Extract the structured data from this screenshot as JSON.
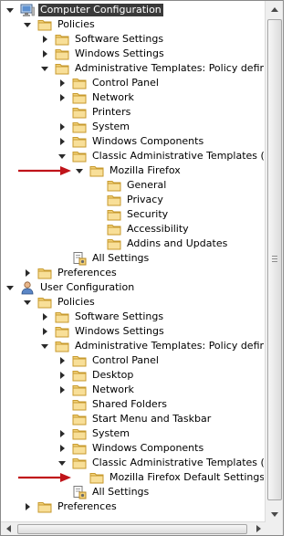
{
  "tree": {
    "rows": [
      {
        "label": "Computer Configuration",
        "level": 0,
        "expander": "down",
        "icon": "computer-icon",
        "selected": true
      },
      {
        "label": "Policies",
        "level": 1,
        "expander": "down",
        "icon": "folder-icon"
      },
      {
        "label": "Software Settings",
        "level": 2,
        "expander": "right",
        "icon": "folder-icon"
      },
      {
        "label": "Windows Settings",
        "level": 2,
        "expander": "right",
        "icon": "folder-icon"
      },
      {
        "label": "Administrative Templates: Policy definitio",
        "level": 2,
        "expander": "down",
        "icon": "folder-icon"
      },
      {
        "label": "Control Panel",
        "level": 3,
        "expander": "right",
        "icon": "folder-icon"
      },
      {
        "label": "Network",
        "level": 3,
        "expander": "right",
        "icon": "folder-icon"
      },
      {
        "label": "Printers",
        "level": 3,
        "expander": "none",
        "icon": "folder-icon"
      },
      {
        "label": "System",
        "level": 3,
        "expander": "right",
        "icon": "folder-icon"
      },
      {
        "label": "Windows Components",
        "level": 3,
        "expander": "right",
        "icon": "folder-icon"
      },
      {
        "label": "Classic Administrative Templates (AD",
        "level": 3,
        "expander": "down",
        "icon": "folder-icon"
      },
      {
        "label": "Mozilla Firefox",
        "level": 4,
        "expander": "down",
        "icon": "folder-icon"
      },
      {
        "label": "General",
        "level": 5,
        "expander": "none",
        "icon": "folder-icon"
      },
      {
        "label": "Privacy",
        "level": 5,
        "expander": "none",
        "icon": "folder-icon"
      },
      {
        "label": "Security",
        "level": 5,
        "expander": "none",
        "icon": "folder-icon"
      },
      {
        "label": "Accessibility",
        "level": 5,
        "expander": "none",
        "icon": "folder-icon"
      },
      {
        "label": "Addins and Updates",
        "level": 5,
        "expander": "none",
        "icon": "folder-icon"
      },
      {
        "label": "All Settings",
        "level": 3,
        "expander": "none",
        "icon": "all-settings-icon"
      },
      {
        "label": "Preferences",
        "level": 1,
        "expander": "right",
        "icon": "folder-icon"
      },
      {
        "label": "User Configuration",
        "level": 0,
        "expander": "down",
        "icon": "user-icon"
      },
      {
        "label": "Policies",
        "level": 1,
        "expander": "down",
        "icon": "folder-icon"
      },
      {
        "label": "Software Settings",
        "level": 2,
        "expander": "right",
        "icon": "folder-icon"
      },
      {
        "label": "Windows Settings",
        "level": 2,
        "expander": "right",
        "icon": "folder-icon"
      },
      {
        "label": "Administrative Templates: Policy definitio",
        "level": 2,
        "expander": "down",
        "icon": "folder-icon"
      },
      {
        "label": "Control Panel",
        "level": 3,
        "expander": "right",
        "icon": "folder-icon"
      },
      {
        "label": "Desktop",
        "level": 3,
        "expander": "right",
        "icon": "folder-icon"
      },
      {
        "label": "Network",
        "level": 3,
        "expander": "right",
        "icon": "folder-icon"
      },
      {
        "label": "Shared Folders",
        "level": 3,
        "expander": "none",
        "icon": "folder-icon"
      },
      {
        "label": "Start Menu and Taskbar",
        "level": 3,
        "expander": "none",
        "icon": "folder-icon"
      },
      {
        "label": "System",
        "level": 3,
        "expander": "right",
        "icon": "folder-icon"
      },
      {
        "label": "Windows Components",
        "level": 3,
        "expander": "right",
        "icon": "folder-icon"
      },
      {
        "label": "Classic Administrative Templates (AD",
        "level": 3,
        "expander": "down",
        "icon": "folder-icon"
      },
      {
        "label": "Mozilla Firefox Default Settings",
        "level": 4,
        "expander": "none",
        "icon": "folder-icon"
      },
      {
        "label": "All Settings",
        "level": 3,
        "expander": "none",
        "icon": "all-settings-icon"
      },
      {
        "label": "Preferences",
        "level": 1,
        "expander": "right",
        "icon": "folder-icon"
      }
    ]
  },
  "annotations": {
    "arrow_rows": [
      11,
      32
    ],
    "arrow_color": "#c0141a"
  },
  "colors": {
    "folder_fill": "#f3d27a",
    "folder_edge": "#c79a2e",
    "selection": "#3a3a3a"
  }
}
